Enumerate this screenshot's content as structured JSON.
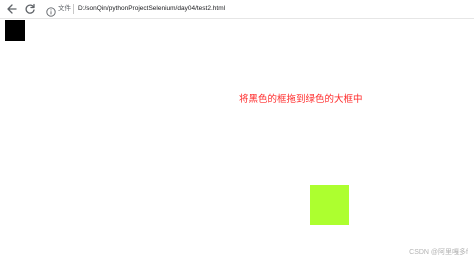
{
  "browser": {
    "security_label": "文件",
    "address": "D:/sonQin/pythonProjectSelenium/day04/test2.html"
  },
  "page": {
    "instruction": "将黑色的框拖到绿色的大框中",
    "drag_box_color": "#000000",
    "drop_target_color": "#adff2f"
  },
  "watermark": "CSDN @阿里嘎多f"
}
